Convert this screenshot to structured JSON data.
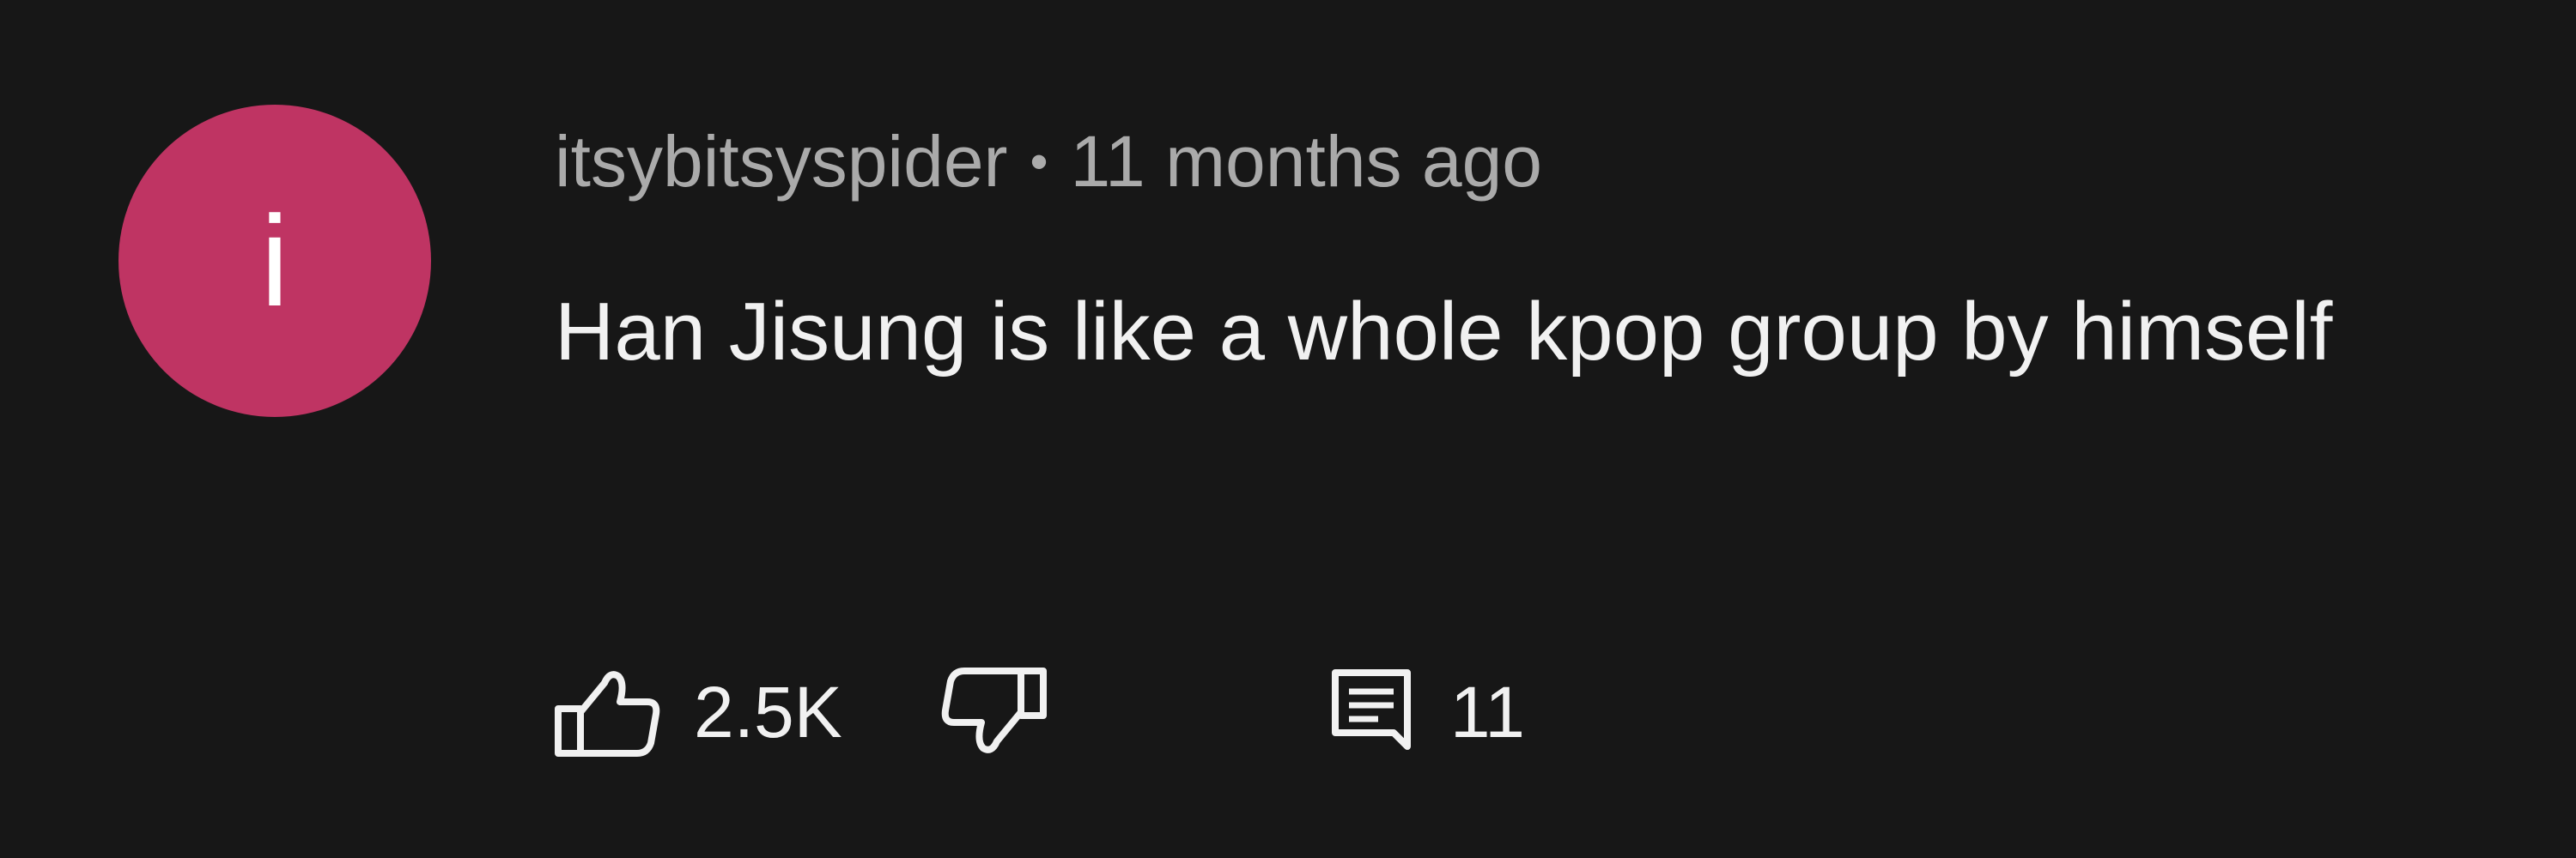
{
  "comment": {
    "author_initial": "i",
    "author": "itsybitsyspider",
    "separator": "•",
    "timestamp": "11 months ago",
    "text": "Han Jisung is like a whole kpop group by himself",
    "avatar_color": "#bf3463",
    "likes": "2.5K",
    "replies": "11",
    "icons": {
      "like": "thumbs-up-icon",
      "dislike": "thumbs-down-icon",
      "reply": "comment-icon"
    }
  }
}
